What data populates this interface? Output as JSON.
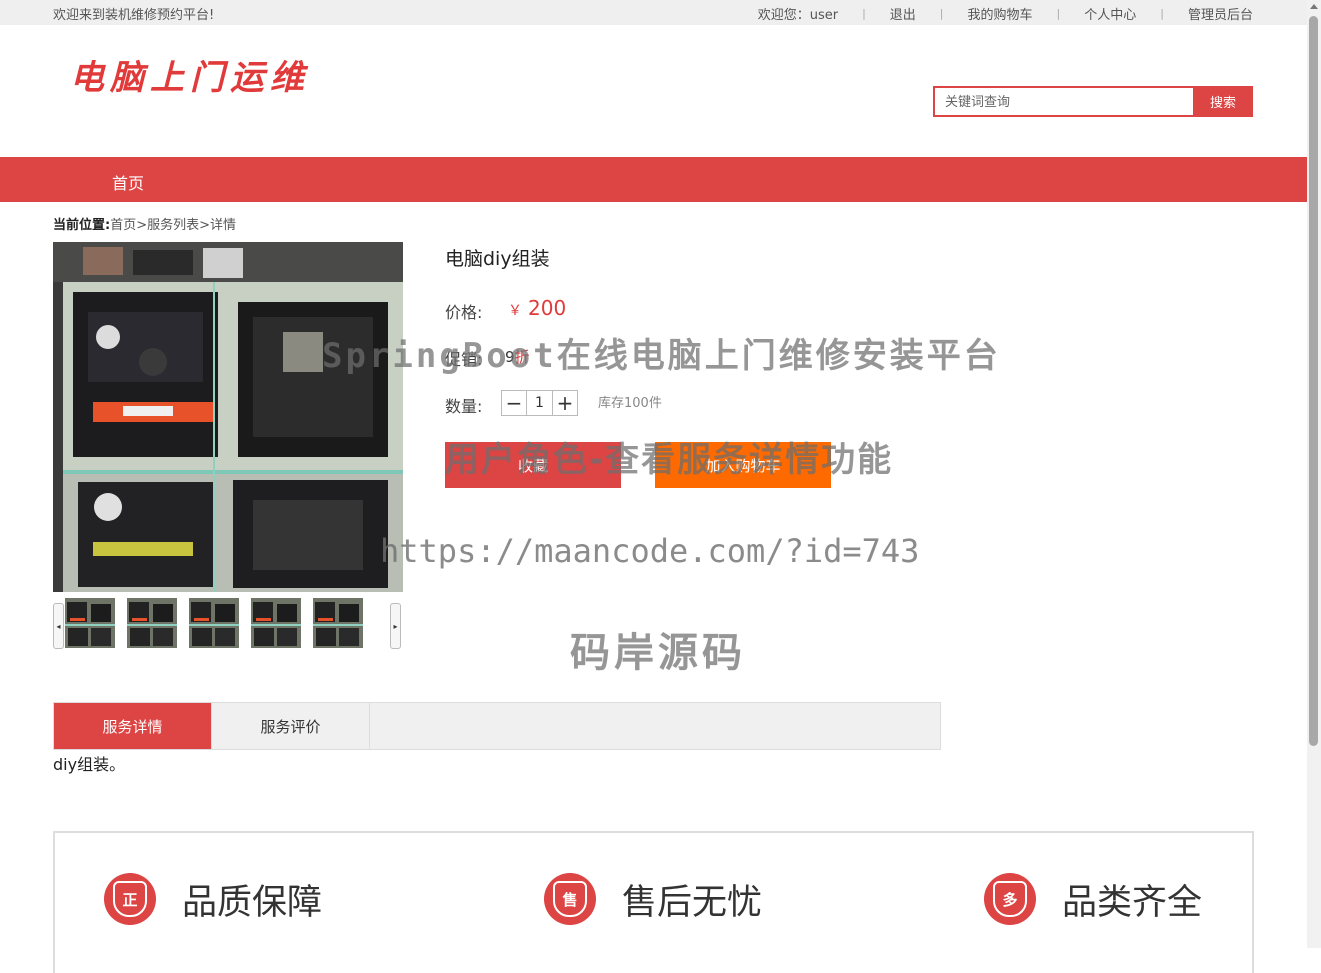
{
  "topbar": {
    "welcome_text": "欢迎来到装机维修预约平台!",
    "greeting": "欢迎您：user",
    "links": [
      "退出",
      "我的购物车",
      "个人中心",
      "管理员后台"
    ]
  },
  "header": {
    "logo_text": "电脑上门运维",
    "search": {
      "placeholder": "关键词查询",
      "button": "搜索"
    }
  },
  "nav": {
    "home": "首页"
  },
  "breadcrumb": {
    "label": "当前位置:",
    "items": [
      "首页",
      "服务列表",
      "详情"
    ],
    "separator": ">"
  },
  "product": {
    "title": "电脑diy组装",
    "price_label": "价格:",
    "currency": "￥",
    "price": "200",
    "promo_label": "促销:",
    "promo_value": "9",
    "promo_unit": "折",
    "qty_label": "数量:",
    "qty_minus": "−",
    "qty_value": "1",
    "qty_plus": "+",
    "stock": "库存100件",
    "fav_button": "收藏",
    "cart_button": "加入购物车"
  },
  "gallery": {
    "thumb_count": 5,
    "prev": "◂",
    "next": "▸"
  },
  "watermark": {
    "line1": "SpringBoot在线电脑上门维修安装平台",
    "line2": "用户角色-查看服务详情功能",
    "line3": "https://maancode.com/?id=743",
    "line4": "码岸源码"
  },
  "tabs": [
    {
      "label": "服务详情",
      "active": true
    },
    {
      "label": "服务评价",
      "active": false
    }
  ],
  "description": "diy组装。",
  "features": [
    {
      "glyph": "正",
      "label": "品质保障",
      "icon": "quality-shield-icon"
    },
    {
      "glyph": "售",
      "label": "售后无忧",
      "icon": "after-sales-shield-icon"
    },
    {
      "glyph": "多",
      "label": "品类齐全",
      "icon": "variety-shield-icon"
    }
  ],
  "colors": {
    "accent": "#dd4444",
    "orange": "#ff6a00",
    "topbar_bg": "#efefef"
  }
}
